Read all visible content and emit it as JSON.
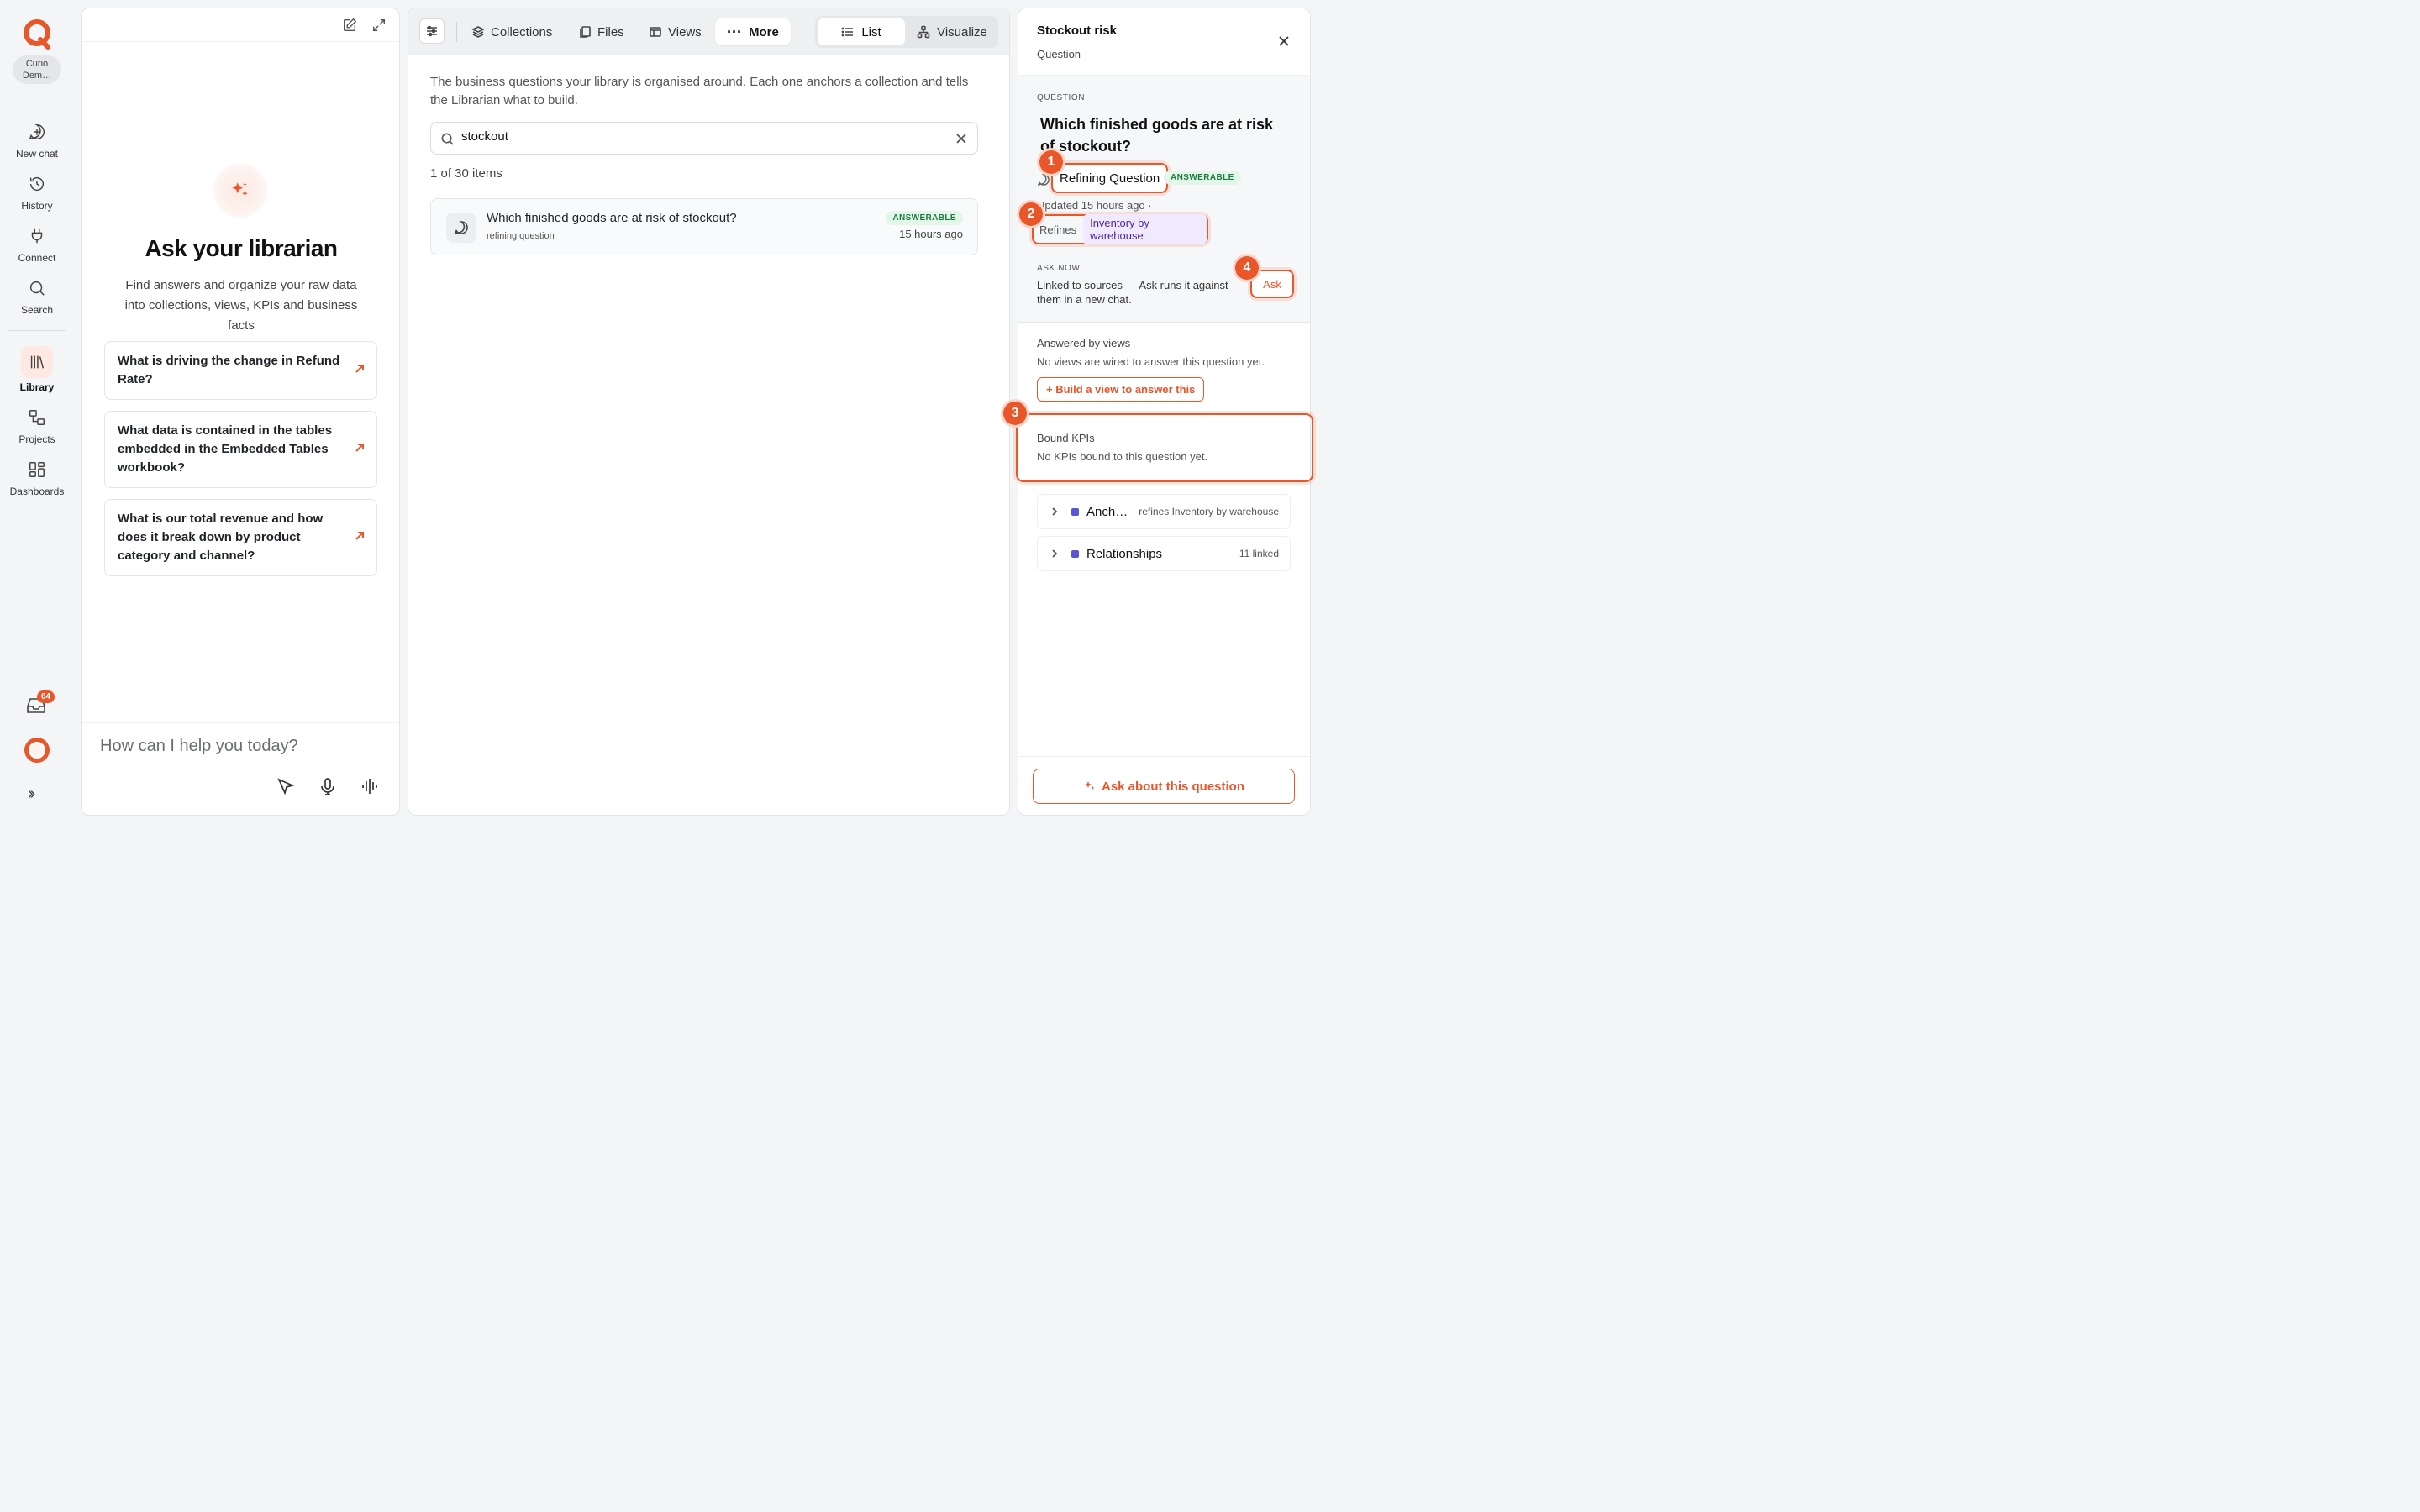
{
  "rail": {
    "org": "Curio Dem…",
    "items": [
      {
        "label": "New chat",
        "icon": "new-chat-icon"
      },
      {
        "label": "History",
        "icon": "history-icon"
      },
      {
        "label": "Connect",
        "icon": "plug-icon"
      },
      {
        "label": "Search",
        "icon": "search-icon"
      },
      {
        "label": "Library",
        "icon": "library-icon",
        "active": true
      },
      {
        "label": "Projects",
        "icon": "projects-icon"
      },
      {
        "label": "Dashboards",
        "icon": "dashboard-icon"
      }
    ],
    "inbox_count": "64"
  },
  "chat": {
    "title": "Ask your librarian",
    "subtitle": "Find answers and organize your raw data into collections, views, KPIs and business facts",
    "suggestions": [
      "What is driving the change in Refund Rate?",
      "What data is contained in the tables embedded in the Embedded Tables workbook?",
      "What is our total revenue and how does it break down by product category and channel?"
    ],
    "input_placeholder": "How can I help you today?"
  },
  "library": {
    "tabs": [
      "Collections",
      "Files",
      "Views",
      "More"
    ],
    "view_modes": [
      "List",
      "Visualize"
    ],
    "active_view_mode": "List",
    "intro": "The business questions your library is organised around. Each one anchors a collection and tells the Librarian what to build.",
    "search_value": "stockout",
    "count_text": "1 of 30 items",
    "rows": [
      {
        "title": "Which finished goods are at risk of stockout?",
        "subtitle": "refining question",
        "status": "ANSWERABLE",
        "time": "15 hours ago"
      }
    ]
  },
  "detail": {
    "title": "Stockout risk",
    "kind": "Question",
    "question_caption": "QUESTION",
    "question": "Which finished goods are at risk of stockout?",
    "type_label": "Refining Question",
    "status": "ANSWERABLE",
    "updated": "Updated 15 hours ago  ·",
    "refines_label": "Refines",
    "refines_target": "Inventory by warehouse",
    "ask_now_caption": "ASK NOW",
    "ask_now_text": "Linked to sources — Ask runs it against them in a new chat.",
    "ask_label": "Ask",
    "answered_label": "Answered by views",
    "answered_note": "No views are wired to answer this question yet.",
    "build_label": "+ Build a view to answer this",
    "kpi_label": "Bound KPIs",
    "kpi_note": "No KPIs bound to this question yet.",
    "sections": [
      {
        "name": "Anch…",
        "meta": "refines Inventory by warehouse"
      },
      {
        "name": "Relationships",
        "meta": "11 linked"
      }
    ],
    "footer_button": "Ask about this question"
  },
  "markers": [
    "1",
    "2",
    "3",
    "4"
  ],
  "colors": {
    "accent": "#e8562a",
    "answerable_bg": "#e3f6ea",
    "answerable_fg": "#1e7a41",
    "chip_bg": "#f1eaff"
  }
}
